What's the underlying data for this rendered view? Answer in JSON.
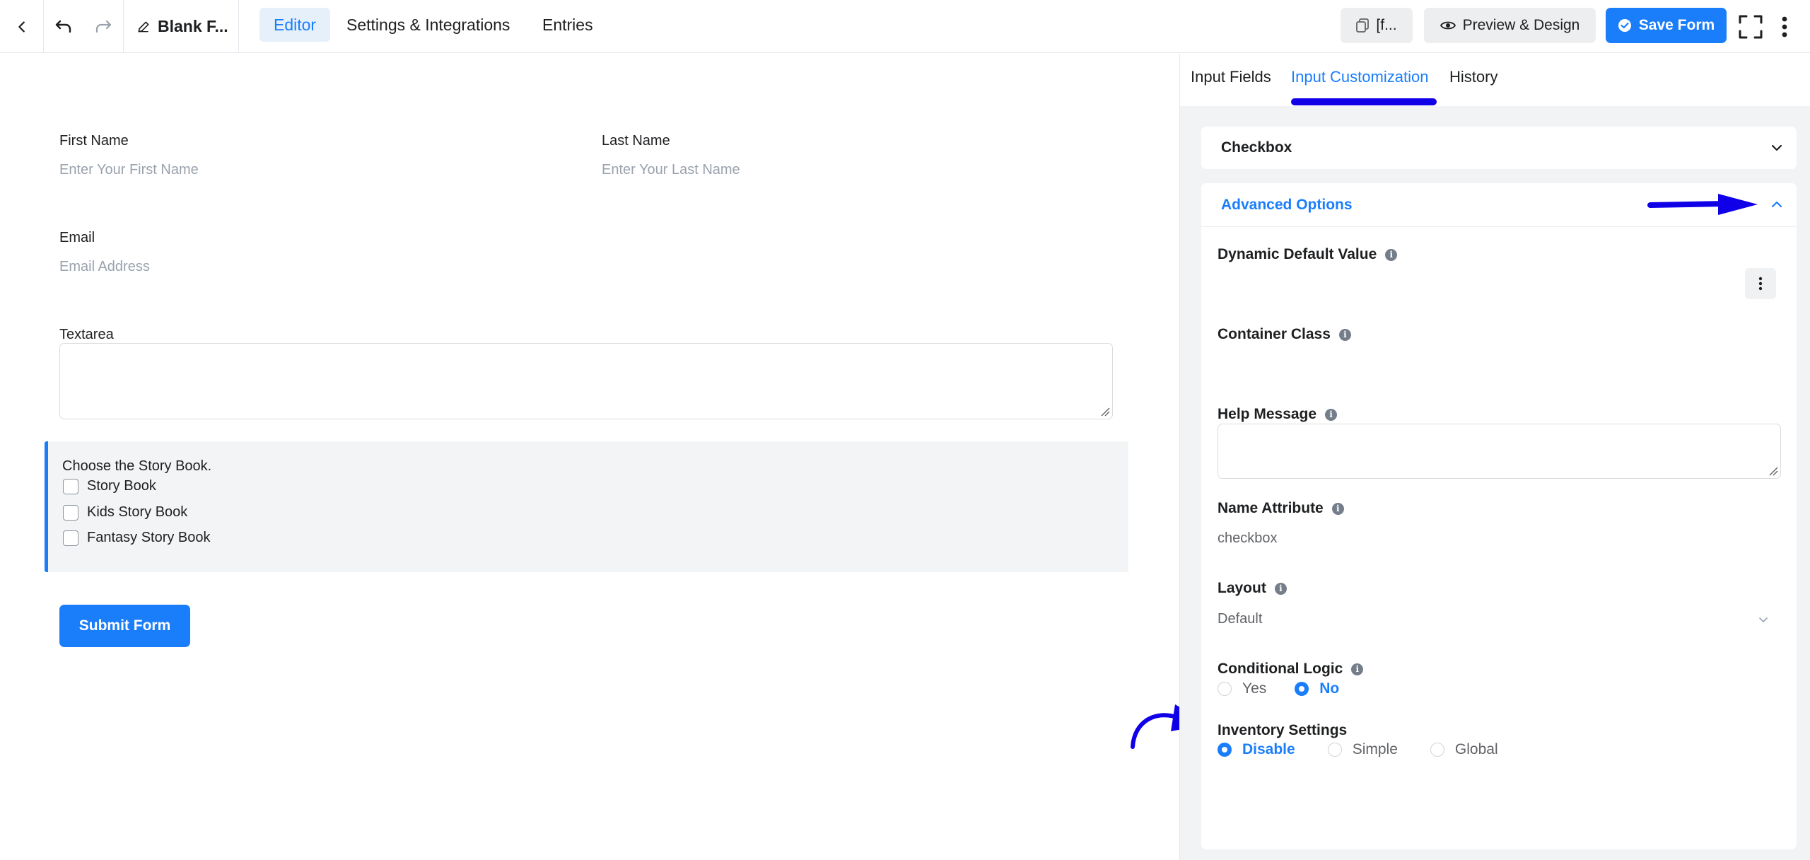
{
  "topbar": {
    "form_title": "Blank F...",
    "tabs": [
      "Editor",
      "Settings & Integrations",
      "Entries"
    ],
    "shortcode_label": "[f...",
    "preview_label": "Preview & Design",
    "save_label": "Save Form"
  },
  "form": {
    "first_name": {
      "label": "First Name",
      "placeholder": "Enter Your First Name"
    },
    "last_name": {
      "label": "Last Name",
      "placeholder": "Enter Your Last Name"
    },
    "email": {
      "label": "Email",
      "placeholder": "Email Address"
    },
    "textarea": {
      "label": "Textarea"
    },
    "checkbox_group": {
      "label": "Choose the Story Book.",
      "options": [
        "Story Book",
        "Kids Story Book",
        "Fantasy Story Book"
      ]
    },
    "submit_label": "Submit Form"
  },
  "panel": {
    "tabs": [
      "Input Fields",
      "Input Customization",
      "History"
    ],
    "active_tab": "Input Customization",
    "checkbox_section": "Checkbox",
    "advanced_section": "Advanced Options",
    "fields": {
      "dynamic_default": "Dynamic Default Value",
      "container_class": "Container Class",
      "help_message": "Help Message",
      "name_attribute": "Name Attribute",
      "name_attribute_value": "checkbox",
      "layout": "Layout",
      "layout_value": "Default",
      "conditional_logic": "Conditional Logic",
      "conditional_options": [
        "Yes",
        "No"
      ],
      "conditional_selected": "No",
      "inventory_settings": "Inventory Settings",
      "inventory_options": [
        "Disable",
        "Simple",
        "Global"
      ],
      "inventory_selected": "Disable"
    }
  },
  "colors": {
    "accent": "#1a7efb",
    "annotation": "#0f00e8",
    "panel_bg": "#f2f3f4"
  },
  "icons": [
    "chevron-left-icon",
    "undo-icon",
    "redo-icon",
    "pencil-icon",
    "copy-icon",
    "eye-icon",
    "check-circle-icon",
    "fullscreen-icon",
    "more-vertical-icon",
    "chevron-down-icon",
    "chevron-up-icon",
    "info-icon",
    "kebab-icon",
    "resize-grip-icon",
    "annotation-arrow-icon"
  ]
}
